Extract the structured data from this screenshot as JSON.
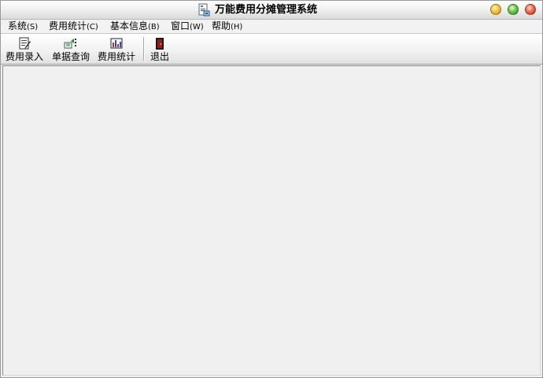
{
  "window": {
    "title": "万能费用分摊管理系统",
    "icon": "document-app-icon",
    "controls": {
      "minimize": "minimize-icon",
      "maximize": "maximize-icon",
      "close": "close-icon"
    }
  },
  "menubar": {
    "items": [
      {
        "label": "系统",
        "accel": "(S)"
      },
      {
        "label": "费用统计",
        "accel": "(C)"
      },
      {
        "label": "基本信息",
        "accel": "(B)"
      },
      {
        "label": "窗口",
        "accel": "(W)"
      },
      {
        "label": "帮助",
        "accel": "(H)"
      }
    ]
  },
  "toolbar": {
    "buttons": [
      {
        "label": "费用录入",
        "icon": "expense-entry-icon"
      },
      {
        "label": "单据查询",
        "icon": "document-query-icon"
      },
      {
        "label": "费用统计",
        "icon": "expense-statistics-icon"
      },
      {
        "label": "退出",
        "icon": "exit-door-icon"
      }
    ]
  },
  "colors": {
    "window_bg": "#f0f0f0",
    "minimize": "#f4c43a",
    "maximize": "#6cc84a",
    "close": "#ef6a4c"
  }
}
